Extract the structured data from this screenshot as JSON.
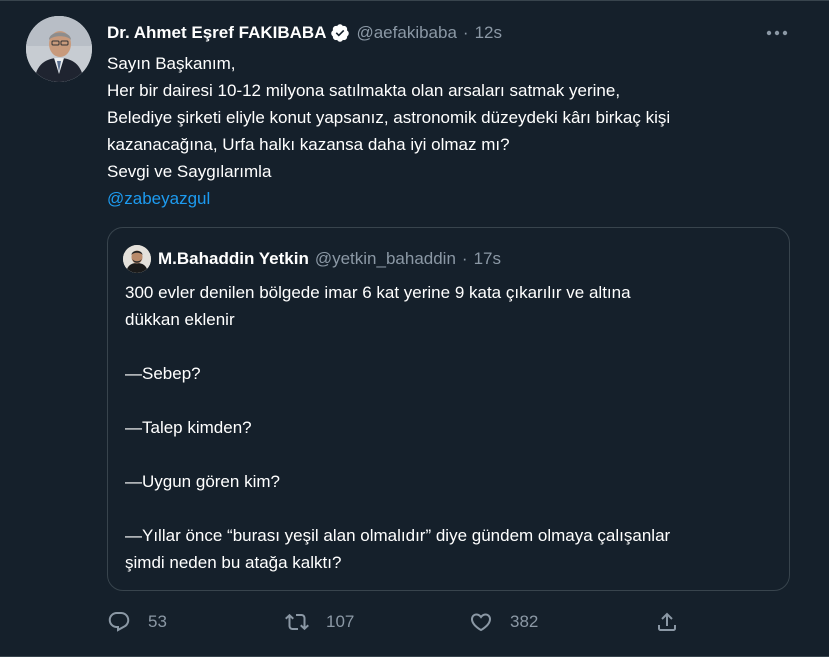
{
  "tweet": {
    "author_name": "Dr. Ahmet Eşref FAKIBABA",
    "author_handle": "@aefakibaba",
    "separator": "·",
    "time": "12s",
    "body_lines": [
      "Sayın Başkanım,",
      "Her bir dairesi 10-12 milyona satılmakta olan arsaları satmak yerine,",
      "Belediye şirketi eliyle konut yapsanız, astronomik düzeydeki kârı birkaç kişi",
      "kazanacağına, Urfa halkı kazansa daha iyi olmaz mı?",
      "Sevgi ve Saygılarımla"
    ],
    "mention": "@zabeyazgul",
    "verified_icon": "verified-badge-icon",
    "more_icon": "more-icon"
  },
  "quote": {
    "author_name": "M.Bahaddin Yetkin",
    "author_handle": "@yetkin_bahaddin",
    "separator": "·",
    "time": "17s",
    "body_lines": [
      "300 evler denilen bölgede imar 6 kat yerine 9 kata çıkarılır ve altına",
      "dükkan eklenir",
      "",
      "—Sebep?",
      "",
      "—Talep kimden?",
      "",
      "—Uygun gören kim?",
      "",
      "—Yıllar önce “burası yeşil alan olmalıdır” diye gündem olmaya çalışanlar",
      "şimdi neden bu atağa kalktı?"
    ]
  },
  "actions": {
    "reply_count": "53",
    "retweet_count": "107",
    "like_count": "382",
    "icons": [
      "reply-icon",
      "retweet-icon",
      "like-icon",
      "share-icon"
    ]
  },
  "colors": {
    "background": "#15202b",
    "text": "#ffffff",
    "secondary": "#8b98a5",
    "accent": "#1d9bf0",
    "border": "#38444d"
  }
}
